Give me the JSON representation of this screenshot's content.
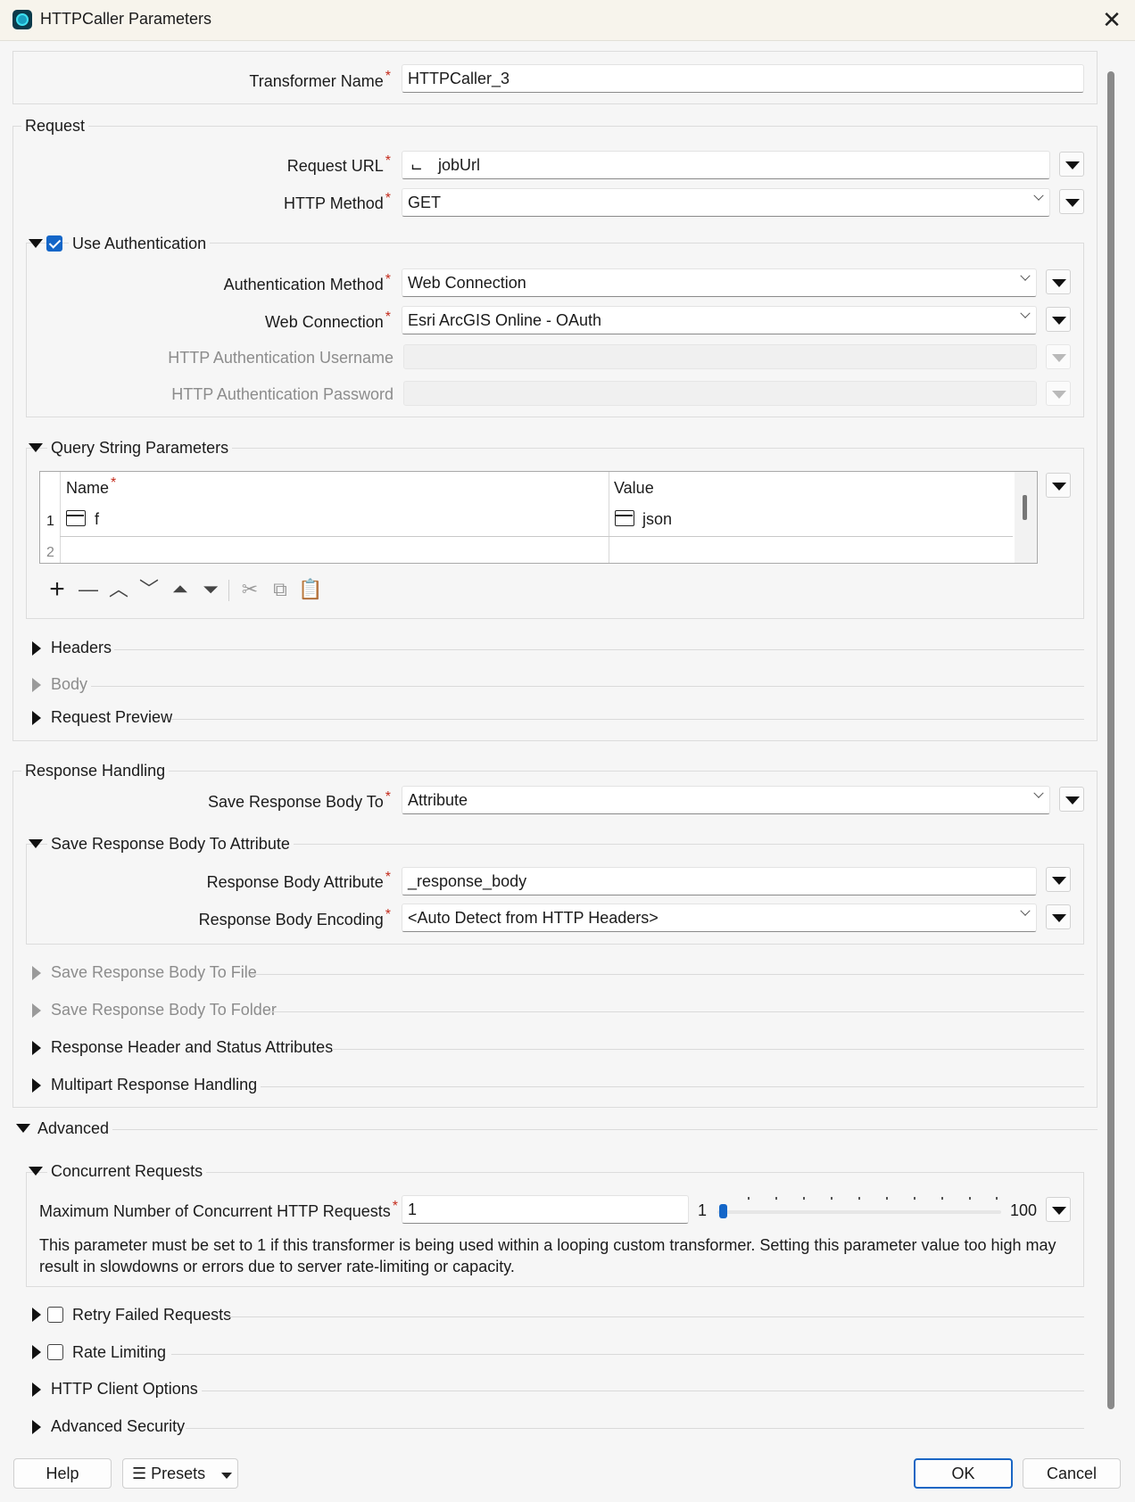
{
  "window": {
    "title": "HTTPCaller Parameters"
  },
  "transformer_name": {
    "label": "Transformer Name",
    "value": "HTTPCaller_3"
  },
  "request": {
    "section_label": "Request",
    "url": {
      "label": "Request URL",
      "value": "jobUrl"
    },
    "method": {
      "label": "HTTP Method",
      "value": "GET"
    },
    "use_auth": {
      "label": "Use Authentication",
      "checked": true,
      "auth_method": {
        "label": "Authentication Method",
        "value": "Web Connection"
      },
      "web_connection": {
        "label": "Web Connection",
        "value": "Esri ArcGIS Online - OAuth"
      },
      "username": {
        "label": "HTTP Authentication Username",
        "value": ""
      },
      "password": {
        "label": "HTTP Authentication Password",
        "value": ""
      }
    },
    "query_params": {
      "label": "Query String Parameters",
      "columns": [
        "Name",
        "Value"
      ],
      "rows": [
        {
          "num": "1",
          "name": "f",
          "value": "json"
        },
        {
          "num": "2",
          "name": "",
          "value": ""
        }
      ]
    },
    "headers_label": "Headers",
    "body_label": "Body",
    "preview_label": "Request Preview"
  },
  "response": {
    "section_label": "Response Handling",
    "save_to": {
      "label": "Save Response Body To",
      "value": "Attribute"
    },
    "attr_group": {
      "label": "Save Response Body To Attribute",
      "attribute": {
        "label": "Response Body Attribute",
        "value": "_response_body"
      },
      "encoding": {
        "label": "Response Body Encoding",
        "value": "<Auto Detect from HTTP Headers>"
      }
    },
    "to_file_label": "Save Response Body To File",
    "to_folder_label": "Save Response Body To Folder",
    "header_status_label": "Response Header and Status Attributes",
    "multipart_label": "Multipart Response Handling"
  },
  "advanced": {
    "section_label": "Advanced",
    "concurrent": {
      "label": "Concurrent Requests",
      "max": {
        "label": "Maximum Number of Concurrent HTTP Requests",
        "value": "1"
      },
      "slider": {
        "min_label": "1",
        "max_label": "100",
        "value": 1
      },
      "note": "This parameter must be set to 1 if this transformer is being used within a looping custom transformer. Setting this parameter value too high may result in slowdowns or errors due to server rate-limiting or capacity."
    },
    "retry_label": "Retry Failed Requests",
    "rate_label": "Rate Limiting",
    "client_label": "HTTP Client Options",
    "security_label": "Advanced Security"
  },
  "footer": {
    "help": "Help",
    "presets": "Presets",
    "ok": "OK",
    "cancel": "Cancel"
  }
}
